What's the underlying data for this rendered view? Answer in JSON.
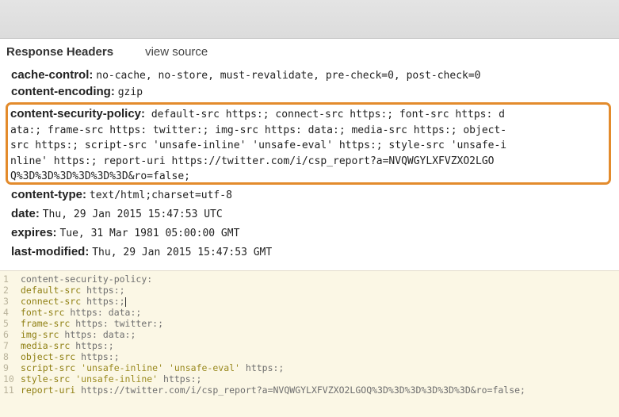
{
  "section": {
    "title": "Response Headers",
    "view_source": "view source"
  },
  "headers": [
    {
      "key": "cache-control:",
      "value": "no-cache, no-store, must-revalidate, pre-check=0, post-check=0"
    },
    {
      "key": "content-encoding:",
      "value": "gzip"
    },
    {
      "key": "content-type:",
      "value": "text/html;charset=utf-8"
    },
    {
      "key": "date:",
      "value": "Thu, 29 Jan 2015 15:47:53 UTC"
    },
    {
      "key": "expires:",
      "value": "Tue, 31 Mar 1981 05:00:00 GMT"
    },
    {
      "key": "last-modified:",
      "value": "Thu, 29 Jan 2015 15:47:53 GMT"
    }
  ],
  "csp": {
    "key": "content-security-policy:",
    "lines": [
      " default-src https:; connect-src https:; font-src https: d",
      "ata:; frame-src https: twitter:; img-src https: data:; media-src https:; object-",
      "src https:; script-src 'unsafe-inline' 'unsafe-eval' https:; style-src 'unsafe-i",
      "nline' https:; report-uri https://twitter.com/i/csp_report?a=NVQWGYLXFVZXO2LGO",
      "Q%3D%3D%3D%3D%3D%3D&ro=false;"
    ]
  },
  "editor": {
    "lines": [
      {
        "num": "1",
        "code": "content-security-policy:"
      },
      {
        "num": "2",
        "prop": "default-src",
        "code": " https:;"
      },
      {
        "num": "3",
        "prop": "connect-src",
        "code": " https:;"
      },
      {
        "num": "4",
        "prop": "font-src",
        "code": " https: data:;"
      },
      {
        "num": "5",
        "prop": "frame-src",
        "code": " https: twitter:;"
      },
      {
        "num": "6",
        "prop": "img-src",
        "code": " https: data:;"
      },
      {
        "num": "7",
        "prop": "media-src",
        "code": " https:;"
      },
      {
        "num": "8",
        "prop": "object-src",
        "code": " https:;"
      },
      {
        "num": "9",
        "prop": "script-src",
        "s1": " 'unsafe-inline'",
        "s2": " 'unsafe-eval'",
        "code": " https:;"
      },
      {
        "num": "10",
        "prop": "style-src",
        "s1": " 'unsafe-inline'",
        "code": " https:;"
      },
      {
        "num": "11",
        "prop": "report-uri",
        "code": " https://twitter.com/i/csp_report?a=NVQWGYLXFVZXO2LGOQ%3D%3D%3D%3D%3D%3D&ro=false;"
      }
    ]
  }
}
